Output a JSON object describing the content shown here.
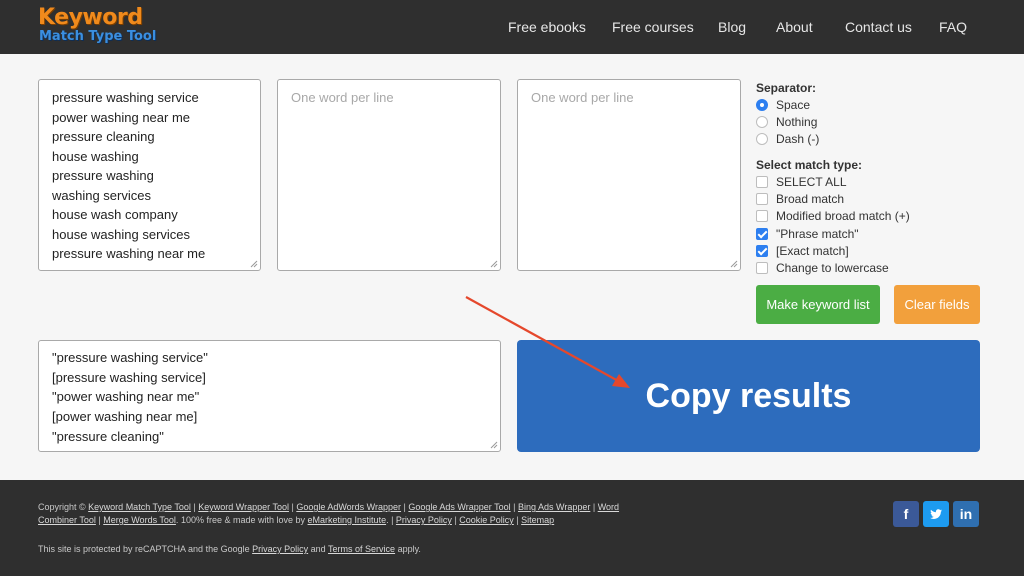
{
  "logo": {
    "line1": "Keyword",
    "line2": "Match Type Tool"
  },
  "nav": [
    "Free ebooks",
    "Free courses",
    "Blog",
    "About",
    "Contact us",
    "FAQ"
  ],
  "input1": {
    "lines": [
      "pressure washing service",
      "power washing near me",
      "pressure cleaning",
      "house washing",
      "pressure washing",
      "washing services",
      "house wash company",
      "house washing services",
      "pressure washing near me"
    ]
  },
  "input2": {
    "placeholder": "One word per line"
  },
  "input3": {
    "placeholder": "One word per line"
  },
  "separator": {
    "title": "Separator:",
    "options": [
      {
        "label": "Space",
        "selected": true
      },
      {
        "label": "Nothing",
        "selected": false
      },
      {
        "label": "Dash (-)",
        "selected": false
      }
    ]
  },
  "match_type": {
    "title": "Select match type:",
    "options": [
      {
        "label": "SELECT ALL",
        "checked": false
      },
      {
        "label": "Broad match",
        "checked": false
      },
      {
        "label": "Modified broad match (+)",
        "checked": false
      },
      {
        "label": "\"Phrase match\"",
        "checked": true
      },
      {
        "label": "[Exact match]",
        "checked": true
      },
      {
        "label": "Change to lowercase",
        "checked": false
      }
    ]
  },
  "buttons": {
    "make": "Make keyword list",
    "clear": "Clear fields",
    "copy": "Copy results"
  },
  "results": {
    "lines": [
      "\"pressure washing service\"",
      "[pressure washing service]",
      "\"power washing near me\"",
      "[power washing near me]",
      "\"pressure cleaning\""
    ]
  },
  "colors": {
    "header_bg": "#2f2f2f",
    "copy_button": "#2d6cbd",
    "make_button": "#4bad44",
    "clear_button": "#f2a03c",
    "arrow": "#e5482c"
  },
  "footer": {
    "copyright": "Copyright ©",
    "links1": [
      "Keyword Match Type Tool",
      "Keyword Wrapper Tool",
      "Google AdWords Wrapper",
      "Google Ads Wrapper Tool",
      "Bing Ads Wrapper",
      "Word"
    ],
    "links2": [
      "Combiner Tool",
      "Merge Words Tool"
    ],
    "free_text": "100% free & made with love by",
    "brand_link": "eMarketing Institute",
    "links3": [
      "Privacy Policy",
      "Cookie Policy",
      "Sitemap"
    ],
    "recaptcha_prefix": "This site is protected by reCAPTCHA and the Google",
    "recaptcha_privacy": "Privacy Policy",
    "recaptcha_and": "and",
    "recaptcha_terms": "Terms of Service",
    "recaptcha_suffix": "apply.",
    "social": [
      {
        "icon": "facebook-icon",
        "glyph": "f"
      },
      {
        "icon": "twitter-icon",
        "glyph": "t"
      },
      {
        "icon": "linkedin-icon",
        "glyph": "in"
      }
    ]
  }
}
